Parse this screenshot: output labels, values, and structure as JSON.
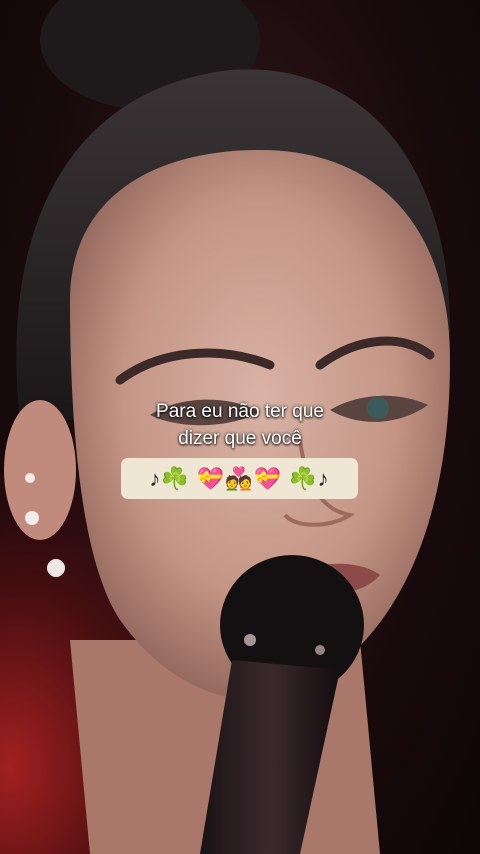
{
  "caption": {
    "line1": "Para eu não ter que",
    "line2": "dizer que você"
  },
  "emoji_bar": {
    "text": "♪☘️ 💝💑💝 ☘️♪"
  },
  "colors": {
    "background": "#1a0a0c",
    "red_glow": "#d22828",
    "emoji_bar_bg": "#efe6d3",
    "caption_text": "#ffffff"
  }
}
